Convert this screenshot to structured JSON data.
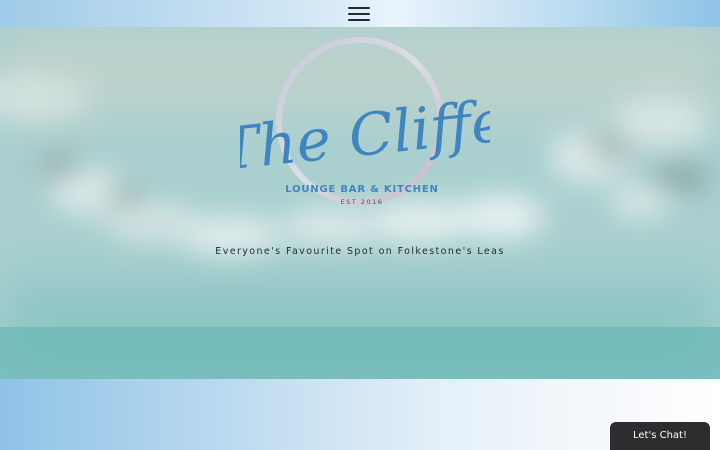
{
  "header": {
    "menu_icon": "hamburger-menu-icon"
  },
  "hero": {
    "logo": {
      "name": "The Cliffe",
      "subtitle": "LOUNGE BAR & KITCHEN",
      "established": "EST 2016",
      "brand_color": "#3f86c0"
    },
    "tagline": "Everyone's Favourite Spot on Folkestone's Leas"
  },
  "chat": {
    "label": "Let's Chat!",
    "color": "#2b2d2f"
  },
  "colors": {
    "topbar_left": "#9fcbe8",
    "topbar_center": "#e9f3fb",
    "hero_sea": "#8fc7c6"
  }
}
